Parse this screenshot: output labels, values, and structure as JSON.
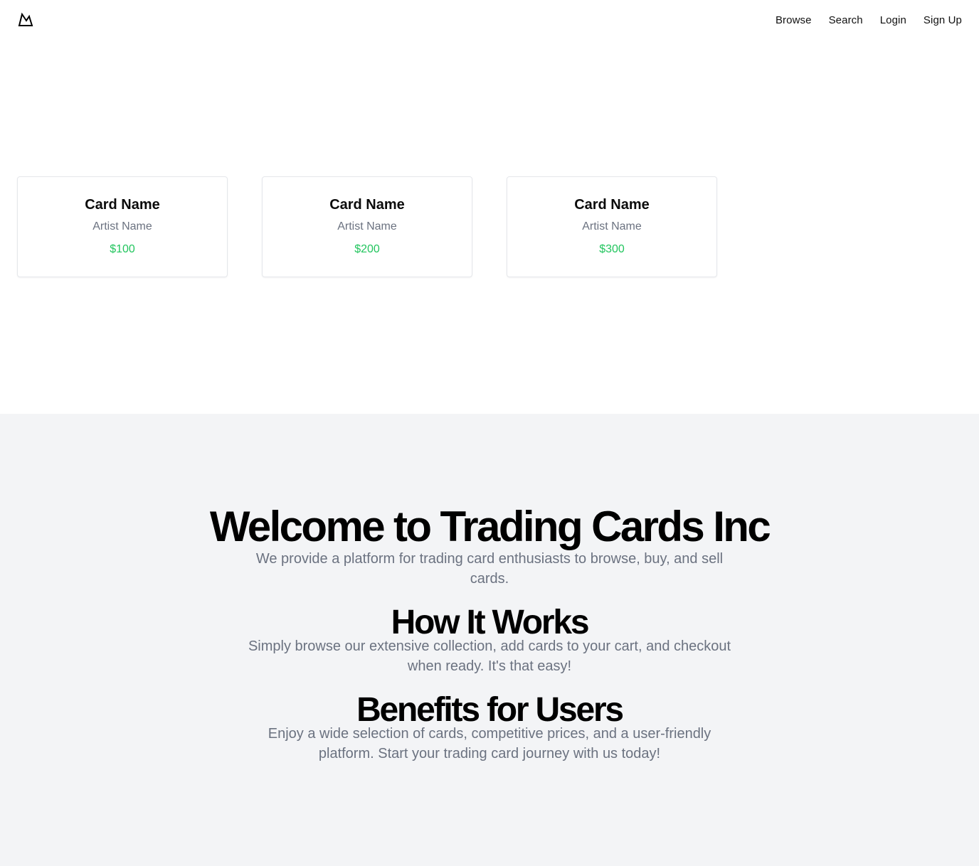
{
  "header": {
    "logo_icon": "mountain-icon",
    "nav": [
      {
        "label": "Browse"
      },
      {
        "label": "Search"
      },
      {
        "label": "Login"
      },
      {
        "label": "Sign Up"
      }
    ]
  },
  "cards": [
    {
      "name": "Card Name",
      "artist": "Artist Name",
      "price": "$100"
    },
    {
      "name": "Card Name",
      "artist": "Artist Name",
      "price": "$200"
    },
    {
      "name": "Card Name",
      "artist": "Artist Name",
      "price": "$300"
    }
  ],
  "about": {
    "title": "Welcome to Trading Cards Inc",
    "intro": "We provide a platform for trading card enthusiasts to browse, buy, and sell cards.",
    "how_title": "How It Works",
    "how_text": "Simply browse our extensive collection, add cards to your cart, and checkout when ready. It's that easy!",
    "benefits_title": "Benefits for Users",
    "benefits_text": "Enjoy a wide selection of cards, competitive prices, and a user-friendly platform. Start your trading card journey with us today!"
  },
  "colors": {
    "price": "#22c55e",
    "muted_text": "#6b7280",
    "section_bg": "#f3f4f6"
  }
}
